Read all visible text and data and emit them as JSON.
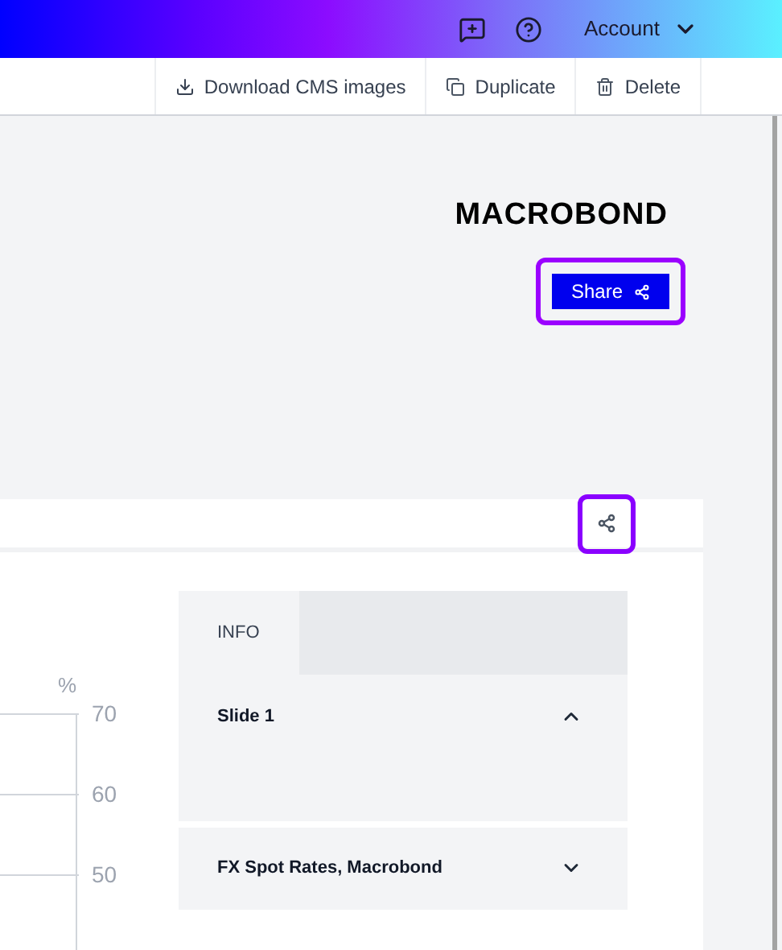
{
  "header": {
    "account": "Account"
  },
  "toolbar": [
    "Download CMS images",
    "Duplicate",
    "Delete"
  ],
  "logo": "MACROBOND",
  "share_button": {
    "label": "Share",
    "focused": true
  },
  "card": {
    "share_focused": true
  },
  "chart_axis": {
    "unit": "%",
    "ticks": [
      "70",
      "60",
      "50"
    ]
  },
  "info_panel": {
    "tabs": [
      {
        "label": "INFO",
        "selected": true
      }
    ],
    "sections": [
      {
        "title": "Slide 1",
        "expanded": true
      },
      {
        "title": "FX Spot Rates, Macrobond",
        "expanded": false
      }
    ]
  }
}
